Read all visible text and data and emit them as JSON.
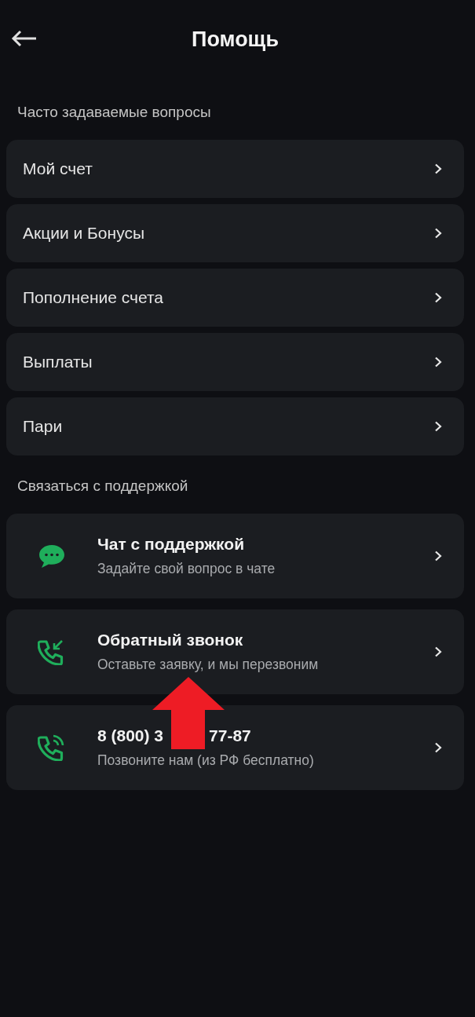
{
  "header": {
    "title": "Помощь"
  },
  "faq": {
    "heading": "Часто задаваемые вопросы",
    "items": [
      {
        "label": "Мой счет"
      },
      {
        "label": "Акции и Бонусы"
      },
      {
        "label": "Пополнение счета"
      },
      {
        "label": "Выплаты"
      },
      {
        "label": "Пари"
      }
    ]
  },
  "support": {
    "heading": "Связаться с поддержкой",
    "items": [
      {
        "kind": "chat",
        "title_parts": [
          "Чат с поддержкой"
        ],
        "subtitle": "Задайте свой вопрос в чате"
      },
      {
        "kind": "callback",
        "title_parts": [
          "Обратный звонок"
        ],
        "subtitle": "Оставьте заявку, и мы перезвоним"
      },
      {
        "kind": "phone",
        "title_parts": [
          "8 (800) 3",
          "77-87"
        ],
        "subtitle": "Позвоните нам (из РФ бесплатно)"
      }
    ]
  },
  "annotation": {
    "kind": "arrow",
    "color": "#ee1c25"
  }
}
